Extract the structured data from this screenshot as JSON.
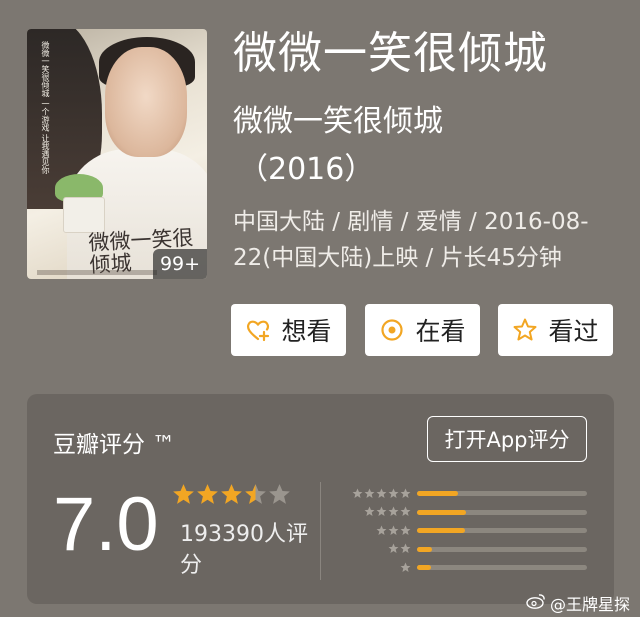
{
  "movie": {
    "title": "微微一笑很倾城",
    "original_title": "微微一笑很倾城",
    "year": "（2016）",
    "meta": "中国大陆 / 剧情 / 爱情 / 2016-08-22(中国大陆)上映 / 片长45分钟",
    "poster": {
      "badge": "99+",
      "title_art": "微微一笑很倾城",
      "side_text": "微微一笑很倾城 一个游戏 让我遇见你"
    }
  },
  "actions": {
    "want": "想看",
    "doing": "在看",
    "done": "看过"
  },
  "rating": {
    "label": "豆瓣评分 ™",
    "open_app": "打开App评分",
    "score": "7.0",
    "stars": 3.5,
    "count": "193390人评分",
    "distribution": [
      {
        "stars": 5,
        "fraction": 0.24
      },
      {
        "stars": 4,
        "fraction": 0.29
      },
      {
        "stars": 3,
        "fraction": 0.28
      },
      {
        "stars": 2,
        "fraction": 0.09
      },
      {
        "stars": 1,
        "fraction": 0.08
      }
    ]
  },
  "colors": {
    "background": "#7c7771",
    "card": "#6b6661",
    "accent": "#f2a623"
  },
  "watermark": "@王牌星探"
}
